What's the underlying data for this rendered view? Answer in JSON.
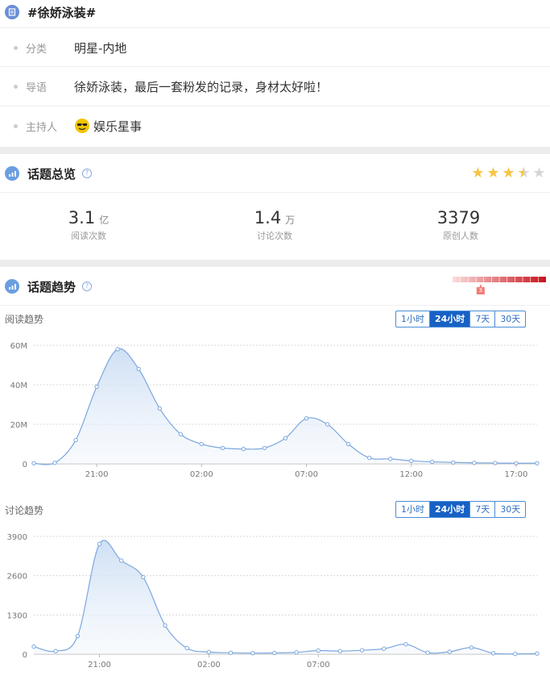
{
  "topic": {
    "title": "#徐娇泳装#",
    "rows": [
      {
        "label": "分类",
        "value": "明星-内地"
      },
      {
        "label": "导语",
        "value": "徐娇泳装，最后一套粉发的记录，身材太好啦！"
      },
      {
        "label": "主持人",
        "value": "娱乐星事"
      }
    ]
  },
  "overview": {
    "title": "话题总览",
    "help": "?",
    "rating": 3.5,
    "stats": [
      {
        "value": "3.1",
        "unit": "亿",
        "caption": "阅读次数"
      },
      {
        "value": "1.4",
        "unit": "万",
        "caption": "讨论次数"
      },
      {
        "value": "3379",
        "unit": "",
        "caption": "原创人数"
      }
    ]
  },
  "trend": {
    "title": "话题趋势",
    "help": "?",
    "heat_marker": "3",
    "heat_level": 0.3,
    "tabs": [
      "1小时",
      "24小时",
      "7天",
      "30天"
    ],
    "active_tab": "24小时"
  },
  "chart_data": [
    {
      "type": "area",
      "title": "阅读趋势",
      "x_ticks": [
        "21:00",
        "02:00",
        "07:00",
        "12:00",
        "17:00"
      ],
      "y_ticks": [
        "0",
        "20M",
        "40M",
        "60M"
      ],
      "ylim": [
        0,
        60
      ],
      "y_unit": "M",
      "values": [
        0.3,
        0.5,
        12,
        39,
        58,
        48,
        28,
        15,
        10,
        8,
        7.5,
        8,
        13,
        23,
        20,
        10,
        3,
        2.5,
        1.5,
        1,
        0.7,
        0.5,
        0.4,
        0.3,
        0.3
      ],
      "grid": true
    },
    {
      "type": "area",
      "title": "讨论趋势",
      "x_ticks": [
        "21:00",
        "02:00",
        "07:00"
      ],
      "y_ticks": [
        "0",
        "1300",
        "2600",
        "3900"
      ],
      "ylim": [
        0,
        3900
      ],
      "values": [
        250,
        100,
        600,
        3650,
        3100,
        2550,
        950,
        200,
        70,
        45,
        35,
        40,
        60,
        120,
        100,
        130,
        180,
        330,
        50,
        80,
        220,
        30,
        10,
        20
      ],
      "grid": true
    }
  ],
  "colors": {
    "accent": "#1761c4",
    "line": "#7ba7de",
    "star": "#f6c544",
    "heat": "#d9222a"
  }
}
